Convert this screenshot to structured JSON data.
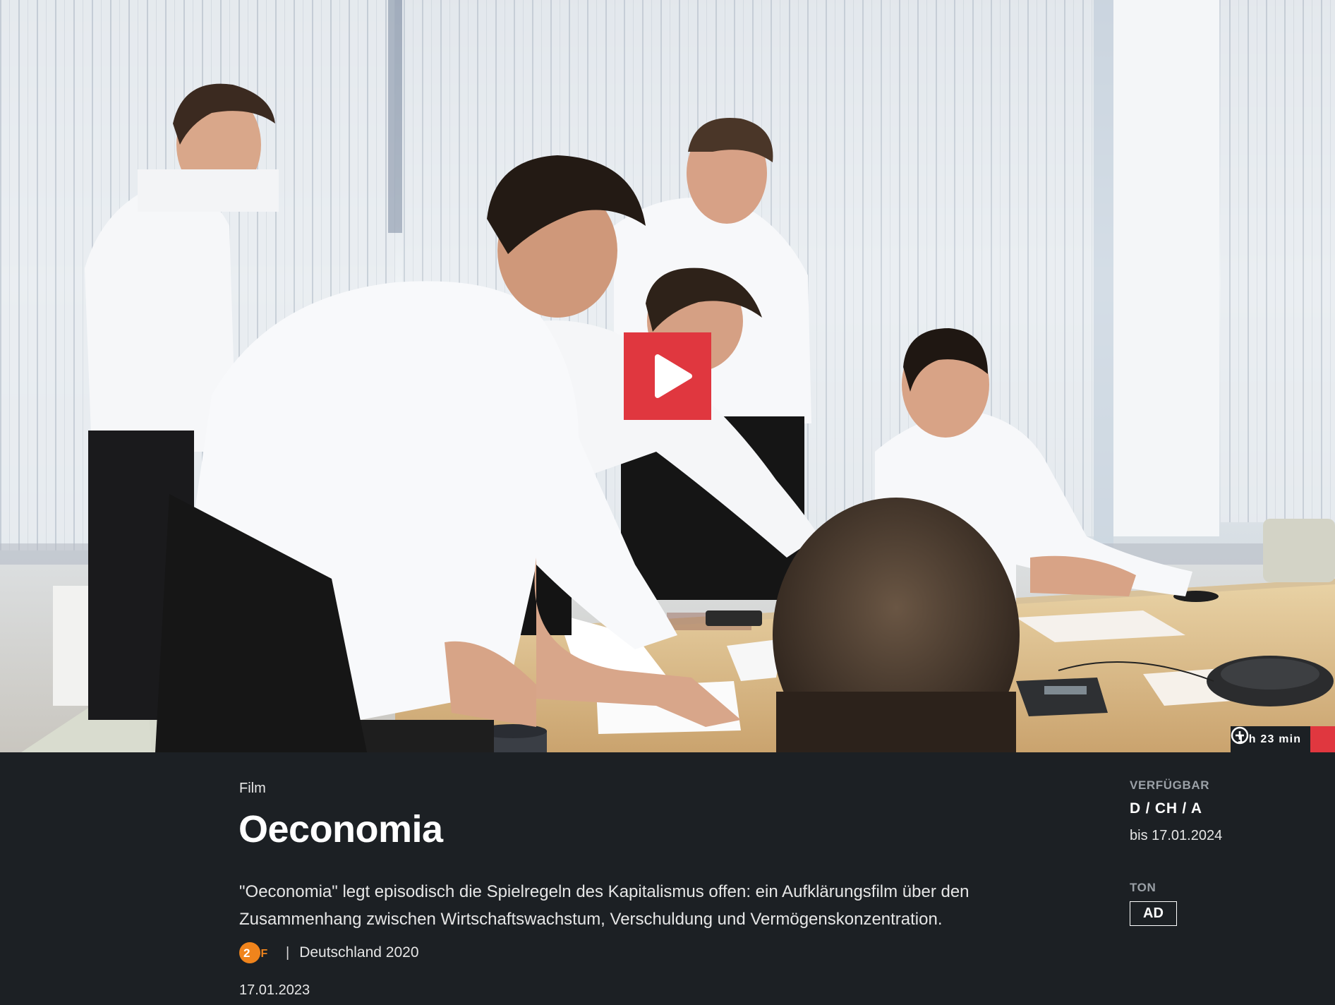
{
  "hero": {
    "play_icon": "play-icon",
    "duration": "1 h 23 min",
    "add_icon": "plus-circle-icon",
    "accent_color": "#e0373f"
  },
  "info": {
    "genre": "Film",
    "title": "Oeconomia",
    "description": "\"Oeconomia\" legt episodisch die Spielregeln des Kapitalismus offen: ein Aufklärungsfilm über den Zusammenhang zwischen Wirtschaftswachstum, Verschuldung und Vermögenskonzentration.",
    "channel_logo": "ZDF",
    "separator": "|",
    "origin": "Deutschland 2020",
    "air_date": "17.01.2023"
  },
  "availability": {
    "label": "VERFÜGBAR",
    "regions": "D / CH / A",
    "until": "bis 17.01.2024"
  },
  "audio": {
    "label": "TON",
    "badge": "AD"
  }
}
